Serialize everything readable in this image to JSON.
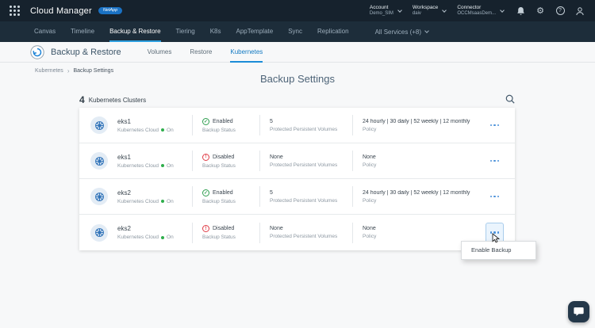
{
  "topbar": {
    "app_title": "Cloud Manager",
    "brand": "NetApp",
    "account_label": "Account",
    "account_value": "Demo_SIM",
    "workspace_label": "Workspace",
    "workspace_value": "daiv",
    "connector_label": "Connector",
    "connector_value": "OCCMsaasDem..."
  },
  "nav": {
    "tabs": [
      "Canvas",
      "Timeline",
      "Backup & Restore",
      "Tiering",
      "K8s",
      "AppTemplate",
      "Sync",
      "Replication"
    ],
    "active_tab": "Backup & Restore",
    "all_services": "All Services (+8)"
  },
  "subheader": {
    "title": "Backup & Restore",
    "tabs": [
      "Volumes",
      "Restore",
      "Kubernetes"
    ],
    "active_tab": "Kubernetes"
  },
  "breadcrumb": {
    "parent": "Kubernetes",
    "current": "Backup Settings"
  },
  "page_title": "Backup Settings",
  "list": {
    "count": "4",
    "count_label": "Kubernetes Clusters",
    "labels": {
      "status": "Backup Status",
      "volumes": "Protected Persistent Volumes",
      "policy": "Policy"
    },
    "rows": [
      {
        "name": "eks1",
        "type": "Kubernetes Cloud",
        "state": "On",
        "status": "Enabled",
        "volumes": "5",
        "policy": "24 hourly | 30 daily | 52 weekly | 12 monthly"
      },
      {
        "name": "eks1",
        "type": "Kubernetes Cloud",
        "state": "On",
        "status": "Disabled",
        "volumes": "None",
        "policy": "None"
      },
      {
        "name": "eks2",
        "type": "Kubernetes Cloud",
        "state": "On",
        "status": "Enabled",
        "volumes": "5",
        "policy": "24 hourly | 30 daily | 52 weekly | 12 monthly"
      },
      {
        "name": "eks2",
        "type": "Kubernetes Cloud",
        "state": "On",
        "status": "Disabled",
        "volumes": "None",
        "policy": "None"
      }
    ]
  },
  "context_menu": {
    "item": "Enable Backup"
  },
  "icons": {
    "gear": "⚙",
    "help": "?",
    "check": "✓",
    "alert": "!",
    "crumb_sep": "›"
  },
  "colors": {
    "accent": "#2d9fe0",
    "green": "#2e9e4f",
    "red": "#e03c46",
    "header": "#16222d"
  }
}
